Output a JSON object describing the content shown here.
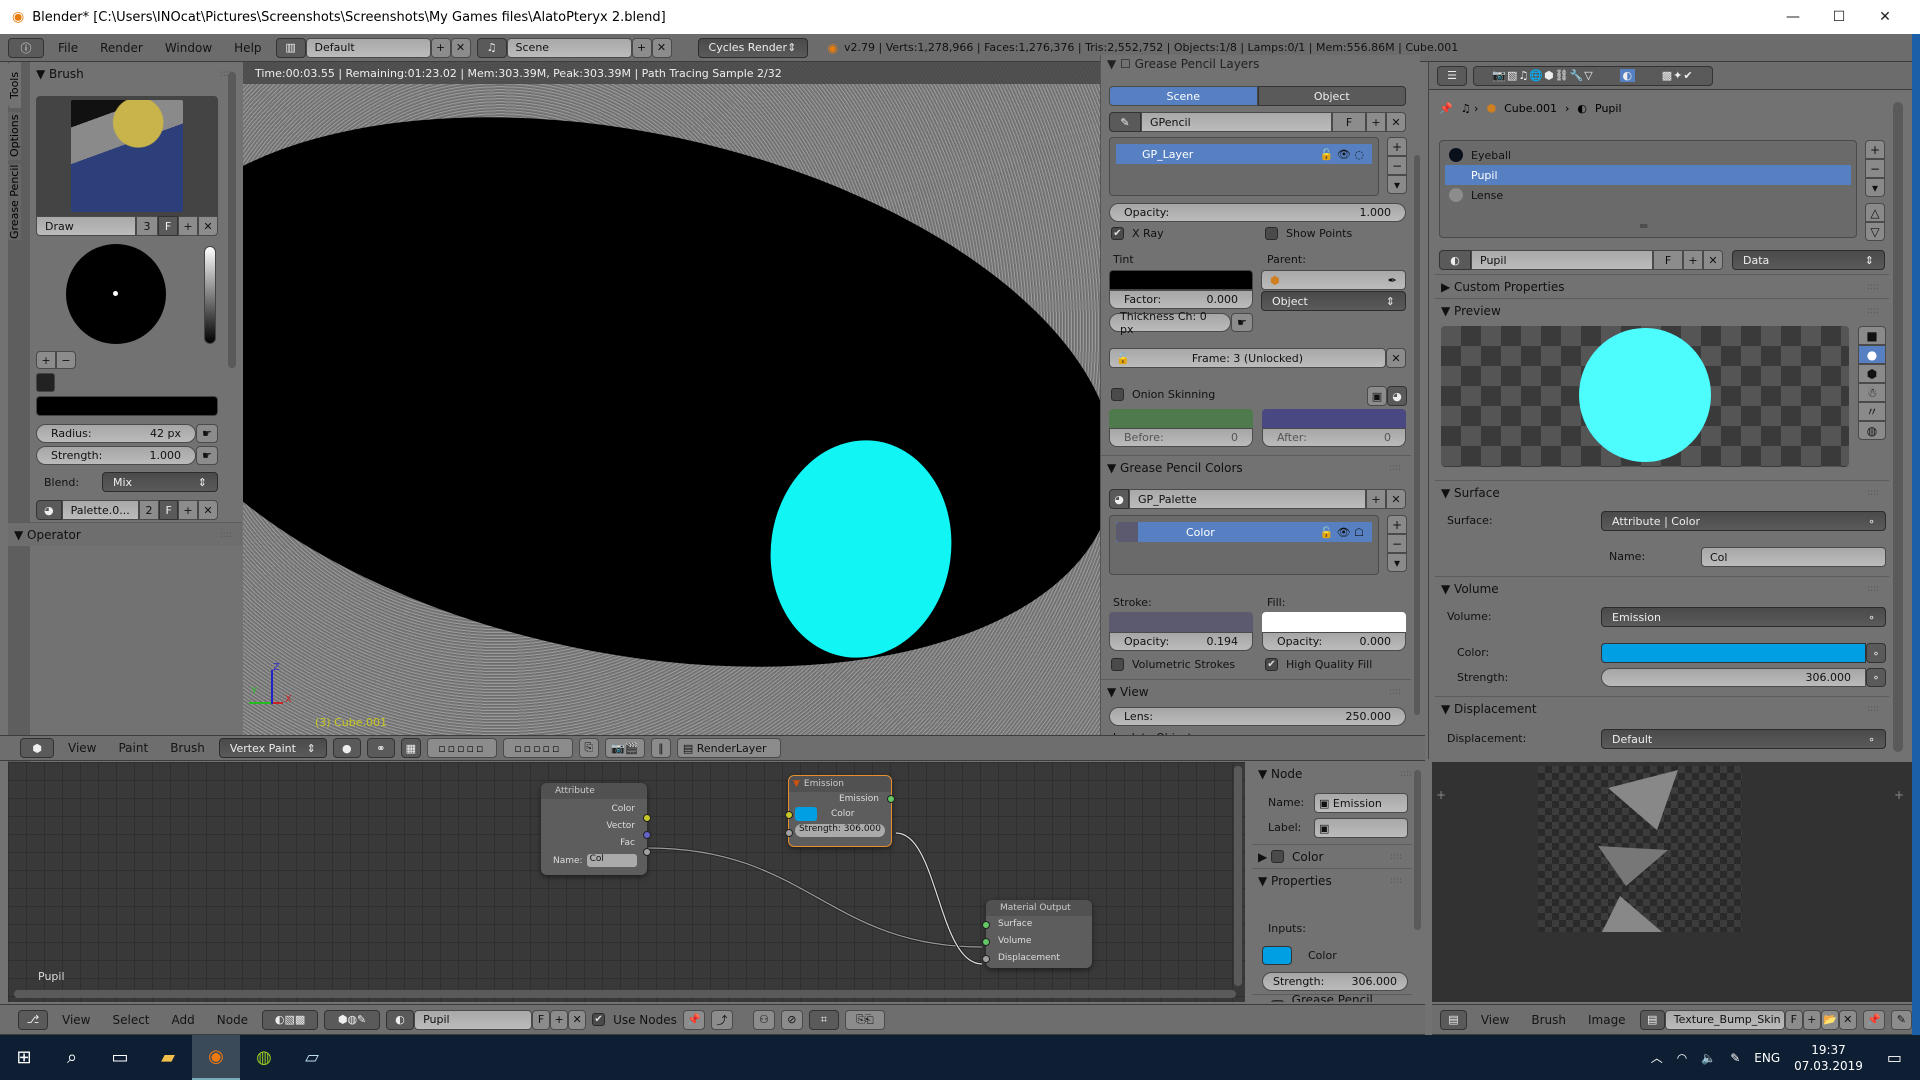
{
  "window": {
    "title": "Blender* [C:\\Users\\INOcat\\Pictures\\Screenshots\\Screenshots\\My Games files\\AlatoPteryx 2.blend]",
    "minimize": "—",
    "maximize": "☐",
    "close": "✕"
  },
  "info_header": {
    "menus": [
      "File",
      "Render",
      "Window",
      "Help"
    ],
    "screen_layout": "Default",
    "scene": "Scene",
    "render_engine": "Cycles Render",
    "stats": "v2.79 | Verts:1,278,966 | Faces:1,276,376 | Tris:2,552,752 | Objects:1/8 | Lamps:0/1 | Mem:556.86M | Cube.001"
  },
  "tool_shelf": {
    "tabs": [
      "Tools",
      "Options",
      "Grease Pencil"
    ],
    "brush_panel_title": "Brush",
    "brush_name": "Draw",
    "brush_users": "3",
    "brush_fake": "F",
    "radius_label": "Radius:",
    "radius_value": "42 px",
    "strength_label": "Strength:",
    "strength_value": "1.000",
    "blend_label": "Blend:",
    "blend_value": "Mix",
    "palette_name": "Palette.0...",
    "palette_users": "2",
    "palette_fake": "F",
    "operator_title": "Operator"
  },
  "viewport": {
    "render_status": "Time:00:03.55 | Remaining:01:23.02 | Mem:303.39M, Peak:303.39M | Path Tracing Sample 2/32",
    "object_label": "(3) Cube.001",
    "axis_x": "X",
    "axis_y": "Y",
    "axis_z": "Z"
  },
  "gp_panel": {
    "section_title": "Grease Pencil Layers",
    "tab_scene": "Scene",
    "tab_object": "Object",
    "datablock": "GPencil",
    "datablock_fake": "F",
    "layers": [
      "GP_Layer"
    ],
    "opacity_label": "Opacity:",
    "opacity_value": "1.000",
    "xray_label": "X Ray",
    "xray_checked": true,
    "show_points_label": "Show Points",
    "show_points_checked": false,
    "tint_label": "Tint",
    "parent_label": "Parent:",
    "factor_label": "Factor:",
    "factor_value": "0.000",
    "parent_type": "Object",
    "thickness_label": "Thickness Ch: 0 px",
    "frame_label": "Frame: 3 (Unlocked)",
    "onion_label": "Onion Skinning",
    "onion_checked": false,
    "before_label": "Before:",
    "before_value": "0",
    "after_label": "After:",
    "after_value": "0",
    "colors_title": "Grease Pencil Colors",
    "palette": "GP_Palette",
    "colors": [
      "Color"
    ],
    "stroke_label": "Stroke:",
    "fill_label": "Fill:",
    "stroke_opacity_label": "Opacity:",
    "stroke_opacity": "0.194",
    "fill_opacity_label": "Opacity:",
    "fill_opacity": "0.000",
    "volumetric_label": "Volumetric Strokes",
    "volumetric_checked": false,
    "hq_fill_label": "High Quality Fill",
    "hq_fill_checked": true,
    "view_title": "View",
    "lens_label": "Lens:",
    "lens_value": "250.000",
    "lock_label": "Lock to Object:",
    "colors_hex": {
      "onion_before": "#4e7a4e",
      "onion_after": "#4a4882",
      "stroke": "#5c5a6e",
      "fill": "#ffffff",
      "tint": "#000000"
    }
  },
  "properties": {
    "breadcrumb": [
      "Cube.001",
      "Pupil"
    ],
    "material_slots": [
      {
        "name": "Eyeball",
        "selected": false
      },
      {
        "name": "Pupil",
        "selected": true
      },
      {
        "name": "Lense",
        "selected": false
      }
    ],
    "material_name": "Pupil",
    "material_fake": "F",
    "link": "Data",
    "custom_props_title": "Custom Properties",
    "preview_title": "Preview",
    "surface_title": "Surface",
    "surface_label": "Surface:",
    "surface_value": "Attribute | Color",
    "name_label": "Name:",
    "name_value": "Col",
    "volume_title": "Volume",
    "volume_label": "Volume:",
    "volume_value": "Emission",
    "color_label": "Color:",
    "strength_label": "Strength:",
    "strength_value": "306.000",
    "displacement_title": "Displacement",
    "displacement_label": "Displacement:",
    "displacement_value": "Default",
    "emission_color": "#009fe3",
    "preview_color": "#4dfdfd"
  },
  "view3d_header": {
    "menus": [
      "View",
      "Paint",
      "Brush"
    ],
    "mode": "Vertex Paint",
    "render_layer": "RenderLayer"
  },
  "node_editor": {
    "material_label": "Pupil",
    "nodes": {
      "attribute": {
        "title": "Attribute",
        "outputs": [
          "Color",
          "Vector",
          "Fac"
        ],
        "name_label": "Name:",
        "name_value": "Col"
      },
      "emission": {
        "title": "Emission",
        "output": "Emission",
        "color_label": "Color",
        "strength": "Strength:  306.000"
      },
      "output": {
        "title": "Material Output",
        "inputs": [
          "Surface",
          "Volume",
          "Displacement"
        ]
      }
    },
    "side_panel": {
      "node_title": "Node",
      "name_label": "Name:",
      "name_value": "Emission",
      "label_label": "Label:",
      "label_value": "",
      "color_title": "Color",
      "properties_title": "Properties",
      "inputs_label": "Inputs:",
      "color_label": "Color",
      "strength_label": "Strength:",
      "strength_value": "306.000",
      "gp_layers_title": "Grease Pencil Layers"
    },
    "header": {
      "menus": [
        "View",
        "Select",
        "Add",
        "Node"
      ],
      "material": "Pupil",
      "fake": "F",
      "use_nodes_label": "Use Nodes",
      "use_nodes_checked": true
    }
  },
  "image_editor": {
    "header": {
      "menus": [
        "View",
        "Brush",
        "Image"
      ],
      "image": "Texture_Bump_Skin",
      "fake": "F"
    }
  },
  "taskbar": {
    "lang": "ENG",
    "time": "19:37",
    "date": "07.03.2019"
  }
}
